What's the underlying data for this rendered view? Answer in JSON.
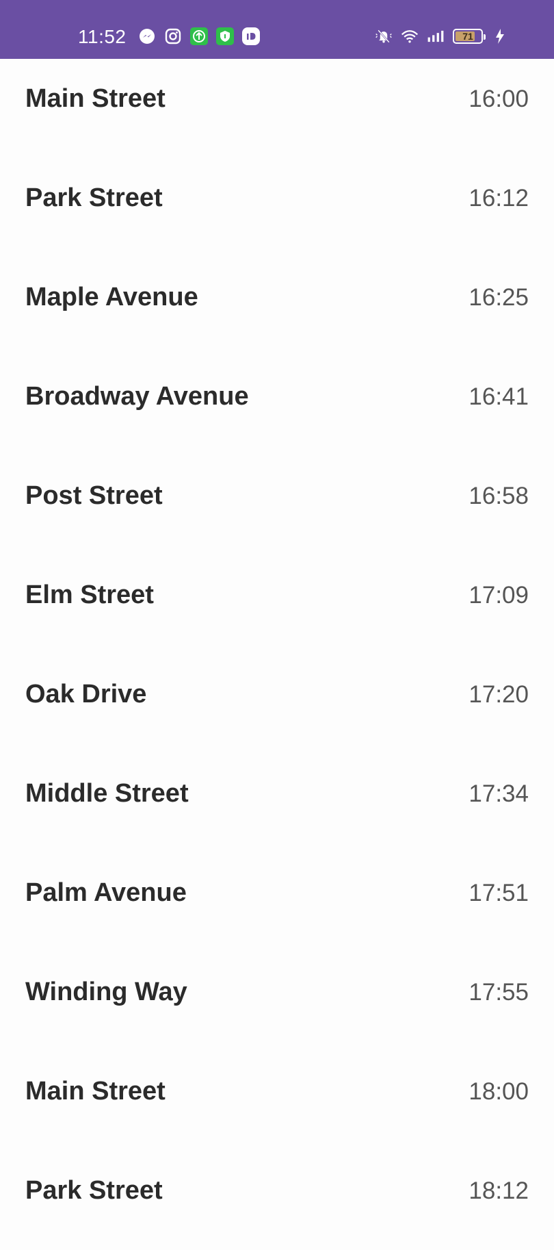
{
  "status_bar": {
    "time": "11:52",
    "background": "#6a4fa3",
    "left_icons": [
      "messenger-icon",
      "instagram-icon",
      "upload-app-icon",
      "shield-app-icon",
      "id-app-icon"
    ],
    "right_icons": [
      "silent-mode-icon",
      "wifi-icon",
      "signal-icon",
      "battery-icon",
      "charging-icon"
    ],
    "battery_percent": "71"
  },
  "stops": [
    {
      "name": "Main Street",
      "time": "16:00"
    },
    {
      "name": "Park Street",
      "time": "16:12"
    },
    {
      "name": "Maple Avenue",
      "time": "16:25"
    },
    {
      "name": "Broadway Avenue",
      "time": "16:41"
    },
    {
      "name": "Post Street",
      "time": "16:58"
    },
    {
      "name": "Elm Street",
      "time": "17:09"
    },
    {
      "name": "Oak Drive",
      "time": "17:20"
    },
    {
      "name": "Middle Street",
      "time": "17:34"
    },
    {
      "name": "Palm Avenue",
      "time": "17:51"
    },
    {
      "name": "Winding Way",
      "time": "17:55"
    },
    {
      "name": "Main Street",
      "time": "18:00"
    },
    {
      "name": "Park Street",
      "time": "18:12"
    }
  ]
}
